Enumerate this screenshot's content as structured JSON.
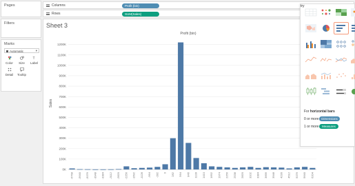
{
  "pages_label": "Pages",
  "filters_label": "Filters",
  "marks": {
    "title": "Marks",
    "type_value": "Automatic",
    "buttons": [
      {
        "label": "Color",
        "icon": "color-dots-icon"
      },
      {
        "label": "Size",
        "icon": "size-circles-icon"
      },
      {
        "label": "Label",
        "icon": "label-text-icon"
      },
      {
        "label": "Detail",
        "icon": "detail-dots-icon"
      },
      {
        "label": "Tooltip",
        "icon": "tooltip-speech-icon"
      }
    ]
  },
  "shelves": {
    "columns_label": "Columns",
    "columns_pill": "Profit (bin)",
    "rows_label": "Rows",
    "rows_pill": "SUM(Sales)"
  },
  "sheet": {
    "title": "Sheet 3"
  },
  "show_me": {
    "hint_prefix": "For",
    "hint_bold": "horizontal bars",
    "hint_suffix": "try",
    "dim_req_prefix": "0 or more",
    "dim_req_pill": "Dimensions",
    "mea_req_prefix": "1 or more",
    "mea_req_pill": "Measures"
  },
  "chart_data": {
    "type": "bar",
    "title": "Profit (bin)",
    "xlabel": "",
    "ylabel": "Sales",
    "categories": [
      "-6768",
      "-5640",
      "-5076",
      "-3948",
      "-3384",
      "-3112",
      "-2820",
      "-2256",
      "-1692",
      "-1128",
      "-564",
      "0",
      "564",
      "1128",
      "1692",
      "2256",
      "2820",
      "3384",
      "3948",
      "4512",
      "5076",
      "5640",
      "6204",
      "6768",
      "7332",
      "7896",
      "8460"
    ],
    "values": [
      10000,
      3000,
      2000,
      1000,
      1000,
      1500,
      4000,
      30000,
      12000,
      15000,
      18000,
      25000,
      50000,
      300000,
      1220000,
      255000,
      110000,
      60000,
      30000,
      25000,
      20000,
      15000,
      20000,
      25000,
      15000,
      22000,
      20000,
      18000,
      10000,
      20000,
      25000,
      15000
    ],
    "y_ticks": [
      "0K",
      "100K",
      "200K",
      "300K",
      "400K",
      "500K",
      "600K",
      "700K",
      "800K",
      "900K",
      "1000K",
      "1100K",
      "1200K"
    ],
    "x_tick_labels": [
      "-6768",
      "-5640",
      "-5076",
      "-3948",
      "-3384",
      "-3112",
      "-2820",
      "-2256",
      "-1692",
      "-1128",
      "-564",
      "-282",
      "0",
      "282",
      "564",
      "846",
      "1128",
      "1410",
      "1692",
      "1974",
      "2256",
      "2538",
      "2820",
      "3102",
      "3384",
      "3666",
      "3948",
      "4230",
      "4512",
      "5076",
      "5640",
      "6204"
    ],
    "ylim": [
      0,
      1250000
    ],
    "bar_color": "#4e79a7",
    "grid": true
  },
  "colors": {
    "dimension_pill": "#4f8db3",
    "measure_pill": "#0e9f80",
    "selection_outline": "#f59a7a"
  }
}
